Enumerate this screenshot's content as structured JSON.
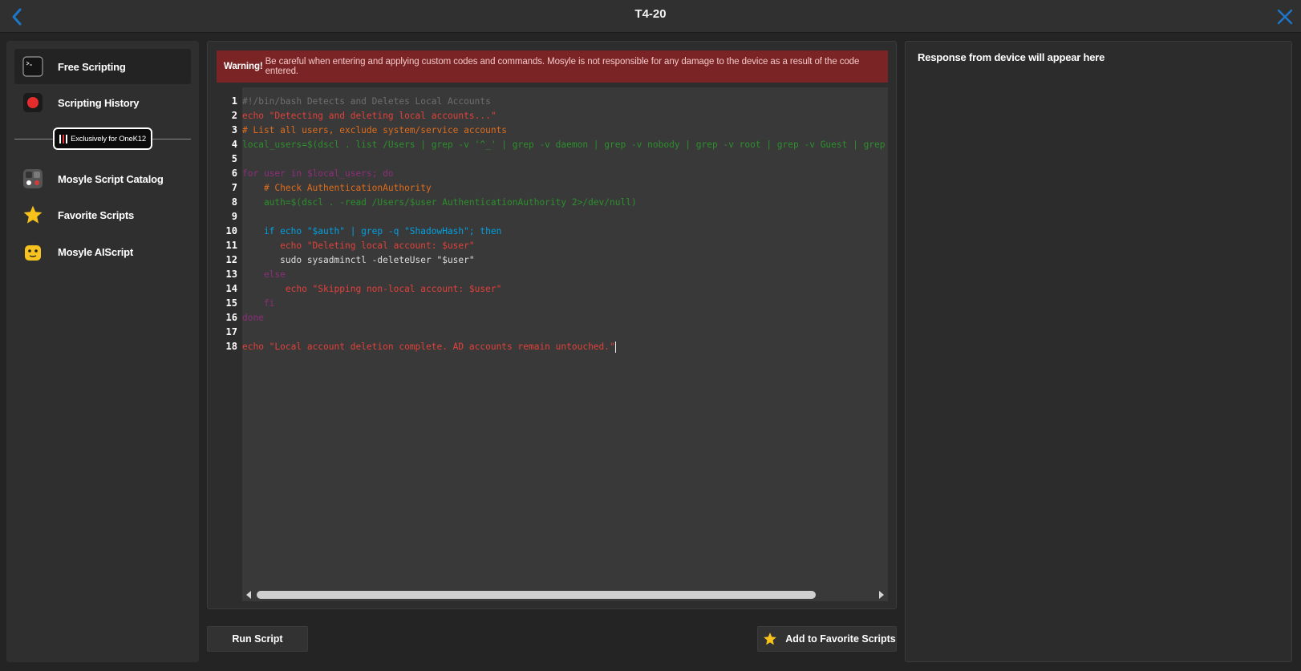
{
  "topbar": {
    "title": "T4-20",
    "back_icon": "chevron-left-icon",
    "close_icon": "close-icon",
    "accent": "#1d76c8"
  },
  "sidebar": {
    "items": [
      {
        "label": "Free Scripting",
        "icon": "terminal-icon",
        "active": true
      },
      {
        "label": "Scripting History",
        "icon": "record-icon"
      },
      {
        "label": "Mosyle Script Catalog",
        "icon": "catalog-icon"
      },
      {
        "label": "Favorite Scripts",
        "icon": "star-icon"
      },
      {
        "label": "Mosyle AIScript",
        "icon": "robot-icon"
      }
    ],
    "badge": "Exclusively for OneK12"
  },
  "warning": {
    "strong": "Warning!",
    "text": "Be careful when entering and applying custom codes and commands. Mosyle is not responsible for any damage to the device as a result of the code entered."
  },
  "editor": {
    "line_numbers": [
      "1",
      "2",
      "3",
      "4",
      "5",
      "6",
      "7",
      "8",
      "9",
      "10",
      "11",
      "12",
      "13",
      "14",
      "15",
      "16",
      "17",
      "18"
    ],
    "lines": [
      "#!/bin/bash Detects and Deletes Local Accounts",
      "echo \"Detecting and deleting local accounts...\"",
      "# List all users, exclude system/service accounts",
      "local_users=$(dscl . list /Users | grep -v '^_' | grep -v daemon | grep -v nobody | grep -v root | grep -v Guest | grep -v",
      "",
      "for user in $local_users; do",
      "    # Check AuthenticationAuthority",
      "    auth=$(dscl . -read /Users/$user AuthenticationAuthority 2>/dev/null)",
      "",
      "    if echo \"$auth\" | grep -q \"ShadowHash\"; then",
      "       echo \"Deleting local account: $user\"",
      "       sudo sysadminctl -deleteUser \"$user\"",
      "    else",
      "        echo \"Skipping non-local account: $user\"",
      "    fi",
      "done",
      "",
      "echo \"Local account deletion complete. AD accounts remain untouched.\""
    ]
  },
  "buttons": {
    "run": "Run Script",
    "favorite": "Add to Favorite Scripts",
    "favorite_icon": "star-icon"
  },
  "response": {
    "placeholder": "Response from device will appear here"
  }
}
